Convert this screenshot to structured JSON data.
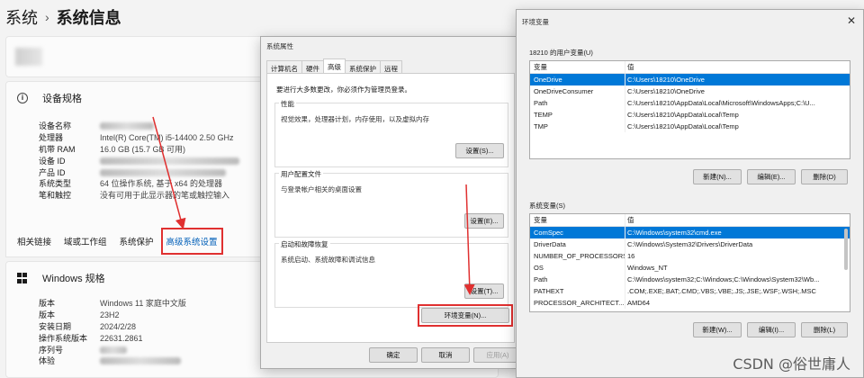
{
  "settings": {
    "breadcrumb_root": "系统",
    "breadcrumb_sep": "›",
    "breadcrumb_current": "系统信息",
    "device_spec_title": "设备规格",
    "device_specs": [
      {
        "k": "设备名称",
        "v": ""
      },
      {
        "k": "处理器",
        "v": "Intel(R) Core(TM) i5-14400   2.50 GHz"
      },
      {
        "k": "机带 RAM",
        "v": "16.0 GB (15.7 GB 可用)"
      },
      {
        "k": "设备 ID",
        "v": ""
      },
      {
        "k": "产品 ID",
        "v": ""
      },
      {
        "k": "系统类型",
        "v": "64 位操作系统, 基于 x64 的处理器"
      },
      {
        "k": "笔和触控",
        "v": "没有可用于此显示器的笔或触控输入"
      }
    ],
    "related_links": [
      "相关链接",
      "域或工作组",
      "系统保护"
    ],
    "advanced_link": "高级系统设置",
    "windows_spec_title": "Windows 规格",
    "windows_specs": [
      {
        "k": "版本",
        "v": "Windows 11 家庭中文版"
      },
      {
        "k": "版本",
        "v": "23H2"
      },
      {
        "k": "安装日期",
        "v": "2024/2/28"
      },
      {
        "k": "操作系统版本",
        "v": "22631.2861"
      },
      {
        "k": "序列号",
        "v": ""
      },
      {
        "k": "体验",
        "v": ""
      }
    ]
  },
  "sysprop": {
    "title": "系统属性",
    "tabs": [
      "计算机名",
      "硬件",
      "高级",
      "系统保护",
      "远程"
    ],
    "active_tab": "高级",
    "note": "要进行大多数更改，你必须作为管理员登录。",
    "perf_title": "性能",
    "perf_desc": "视觉效果，处理器计划，内存使用，以及虚拟内存",
    "perf_btn": "设置(S)...",
    "profile_title": "用户配置文件",
    "profile_desc": "与登录帐户相关的桌面设置",
    "profile_btn": "设置(E)...",
    "startup_title": "启动和故障恢复",
    "startup_desc": "系统启动、系统故障和调试信息",
    "startup_btn": "设置(T)...",
    "env_btn": "环境变量(N)...",
    "ok": "确定",
    "cancel": "取消",
    "apply": "应用(A)"
  },
  "envvars": {
    "title": "环境变量",
    "user_section": "18210 的用户变量(U)",
    "col_var": "变量",
    "col_val": "值",
    "user_vars": [
      {
        "k": "OneDrive",
        "v": "C:\\Users\\18210\\OneDrive"
      },
      {
        "k": "OneDriveConsumer",
        "v": "C:\\Users\\18210\\OneDrive"
      },
      {
        "k": "Path",
        "v": "C:\\Users\\18210\\AppData\\Local\\Microsoft\\WindowsApps;C:\\U..."
      },
      {
        "k": "TEMP",
        "v": "C:\\Users\\18210\\AppData\\Local\\Temp"
      },
      {
        "k": "TMP",
        "v": "C:\\Users\\18210\\AppData\\Local\\Temp"
      }
    ],
    "user_btns": [
      "新建(N)...",
      "编辑(E)...",
      "删除(D)"
    ],
    "sys_section": "系统变量(S)",
    "sys_vars": [
      {
        "k": "ComSpec",
        "v": "C:\\Windows\\system32\\cmd.exe"
      },
      {
        "k": "DriverData",
        "v": "C:\\Windows\\System32\\Drivers\\DriverData"
      },
      {
        "k": "NUMBER_OF_PROCESSORS",
        "v": "16"
      },
      {
        "k": "OS",
        "v": "Windows_NT"
      },
      {
        "k": "Path",
        "v": "C:\\Windows\\system32;C:\\Windows;C:\\Windows\\System32\\Wb..."
      },
      {
        "k": "PATHEXT",
        "v": ".COM;.EXE;.BAT;.CMD;.VBS;.VBE;.JS;.JSE;.WSF;.WSH;.MSC"
      },
      {
        "k": "PROCESSOR_ARCHITECT...",
        "v": "AMD64"
      }
    ],
    "sys_btns": [
      "新建(W)...",
      "编辑(I)...",
      "删除(L)"
    ],
    "watermark": "CSDN @俗世庸人"
  },
  "colors": {
    "highlight": "#e03030",
    "selection": "#0078d7",
    "link": "#005fb8"
  }
}
